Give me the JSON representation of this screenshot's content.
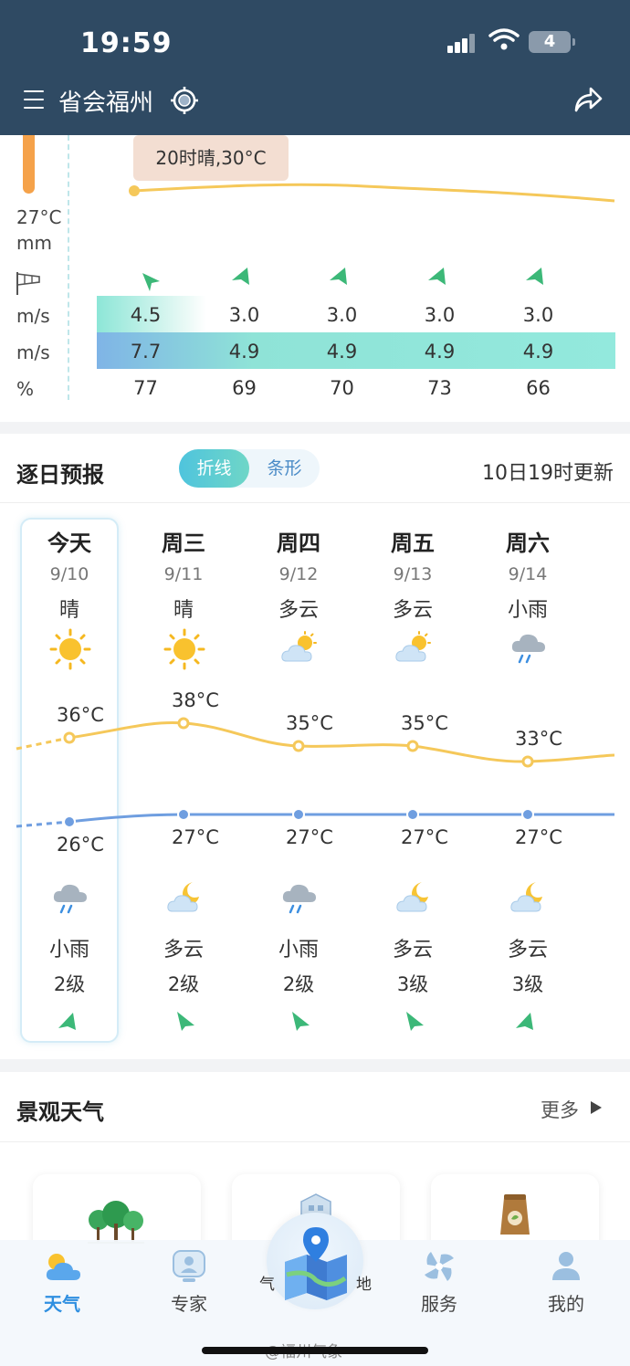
{
  "status_bar": {
    "time": "19:59",
    "battery": "4"
  },
  "header": {
    "city": "省会福州"
  },
  "hourly": {
    "tooltip": "20时晴,30°C",
    "labels": {
      "temp": "27°C",
      "rain": "mm",
      "wind_speed": "m/s",
      "gust": "m/s",
      "humidity": "%"
    },
    "wind_speed": [
      "4.5",
      "3.0",
      "3.0",
      "3.0",
      "3.0"
    ],
    "gust": [
      "7.7",
      "4.9",
      "4.9",
      "4.9",
      "4.9"
    ],
    "humidity": [
      "77",
      "69",
      "70",
      "73",
      "66"
    ]
  },
  "daily": {
    "title": "逐日预报",
    "toggle": {
      "line": "折线",
      "bar": "条形",
      "selected": "折线"
    },
    "update_time": "10日19时更新",
    "days": [
      {
        "name": "今天",
        "date": "9/10",
        "day_cond": "晴",
        "day_icon": "sun-icon",
        "high": "36°C",
        "low": "26°C",
        "night_icon": "rain-cloud-icon",
        "night_cond": "小雨",
        "wind_level": "2级"
      },
      {
        "name": "周三",
        "date": "9/11",
        "day_cond": "晴",
        "day_icon": "sun-icon",
        "high": "38°C",
        "low": "27°C",
        "night_icon": "moon-cloud-icon",
        "night_cond": "多云",
        "wind_level": "2级"
      },
      {
        "name": "周四",
        "date": "9/12",
        "day_cond": "多云",
        "day_icon": "sun-cloud-icon",
        "high": "35°C",
        "low": "27°C",
        "night_icon": "rain-cloud-icon",
        "night_cond": "小雨",
        "wind_level": "2级"
      },
      {
        "name": "周五",
        "date": "9/13",
        "day_cond": "多云",
        "day_icon": "sun-cloud-icon",
        "high": "35°C",
        "low": "27°C",
        "night_icon": "moon-cloud-icon",
        "night_cond": "多云",
        "wind_level": "3级"
      },
      {
        "name": "周六",
        "date": "9/14",
        "day_cond": "小雨",
        "day_icon": "rain-cloud-icon",
        "high": "33°C",
        "low": "27°C",
        "night_icon": "moon-cloud-icon",
        "night_cond": "多云",
        "wind_level": "3级"
      }
    ],
    "colors": {
      "high_line": "#f5c85a",
      "low_line": "#6f9ee0",
      "wind_arrow": "#3cb878"
    }
  },
  "scenic": {
    "title": "景观天气",
    "more": "更多"
  },
  "nav": {
    "items": [
      {
        "label": "天气",
        "icon": "weather-icon",
        "active": true
      },
      {
        "label": "专家",
        "icon": "expert-icon",
        "active": false
      },
      {
        "label": "服务",
        "icon": "service-icon",
        "active": false
      },
      {
        "label": "我的",
        "icon": "profile-icon",
        "active": false
      }
    ],
    "center_left": "气",
    "center_right": "地",
    "watermark": "@福州气象"
  }
}
